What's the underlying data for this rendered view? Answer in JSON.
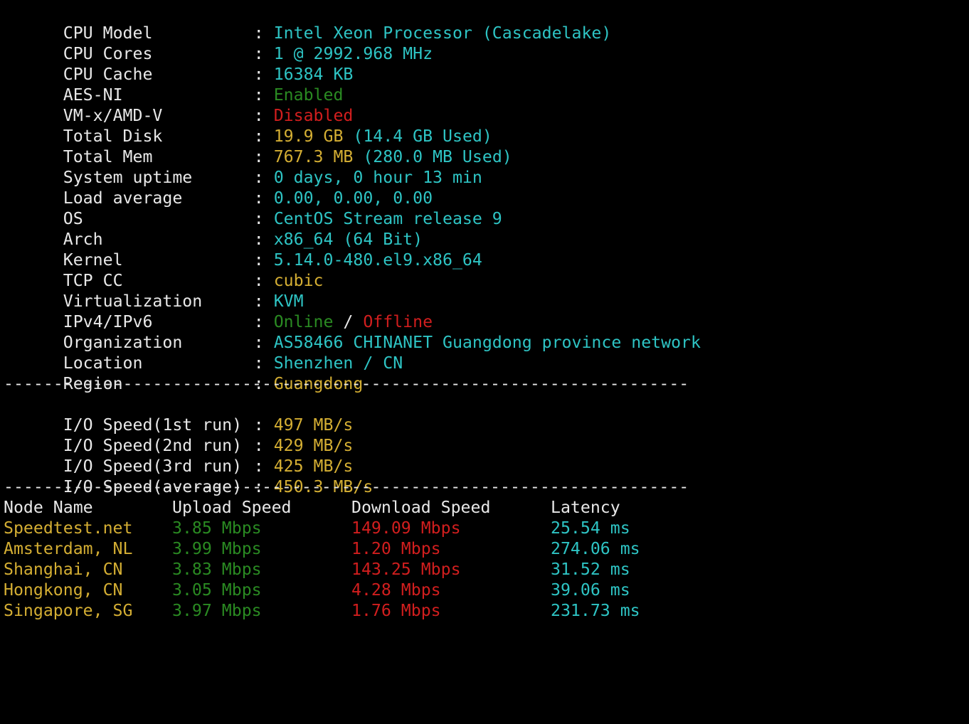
{
  "colors": {
    "background": "#000000",
    "label": "#e8e8e8",
    "cyan": "#2ec4c4",
    "green": "#2a8a22",
    "red": "#d11e1e",
    "yellow": "#d4ae33"
  },
  "sysinfo": [
    {
      "key": "CPU Model",
      "parts": [
        {
          "text": "Intel Xeon Processor (Cascadelake)",
          "color": "cyan"
        }
      ]
    },
    {
      "key": "CPU Cores",
      "parts": [
        {
          "text": "1 @ 2992.968 MHz",
          "color": "cyan"
        }
      ]
    },
    {
      "key": "CPU Cache",
      "parts": [
        {
          "text": "16384 KB",
          "color": "cyan"
        }
      ]
    },
    {
      "key": "AES-NI",
      "parts": [
        {
          "text": "Enabled",
          "color": "green"
        }
      ]
    },
    {
      "key": "VM-x/AMD-V",
      "parts": [
        {
          "text": "Disabled",
          "color": "red"
        }
      ]
    },
    {
      "key": "Total Disk",
      "parts": [
        {
          "text": "19.9 GB",
          "color": "yellow"
        },
        {
          "text": " (14.4 GB Used)",
          "color": "cyan"
        }
      ]
    },
    {
      "key": "Total Mem",
      "parts": [
        {
          "text": "767.3 MB",
          "color": "yellow"
        },
        {
          "text": " (280.0 MB Used)",
          "color": "cyan"
        }
      ]
    },
    {
      "key": "System uptime",
      "parts": [
        {
          "text": "0 days, 0 hour 13 min",
          "color": "cyan"
        }
      ]
    },
    {
      "key": "Load average",
      "parts": [
        {
          "text": "0.00, 0.00, 0.00",
          "color": "cyan"
        }
      ]
    },
    {
      "key": "OS",
      "parts": [
        {
          "text": "CentOS Stream release 9",
          "color": "cyan"
        }
      ]
    },
    {
      "key": "Arch",
      "parts": [
        {
          "text": "x86_64 (64 Bit)",
          "color": "cyan"
        }
      ]
    },
    {
      "key": "Kernel",
      "parts": [
        {
          "text": "5.14.0-480.el9.x86_64",
          "color": "cyan"
        }
      ]
    },
    {
      "key": "TCP CC",
      "parts": [
        {
          "text": "cubic",
          "color": "yellow"
        }
      ]
    },
    {
      "key": "Virtualization",
      "parts": [
        {
          "text": "KVM",
          "color": "cyan"
        }
      ]
    },
    {
      "key": "IPv4/IPv6",
      "parts": [
        {
          "text": "Online",
          "color": "green"
        },
        {
          "text": " / ",
          "color": "white"
        },
        {
          "text": "Offline",
          "color": "red"
        }
      ]
    },
    {
      "key": "Organization",
      "parts": [
        {
          "text": "AS58466 CHINANET Guangdong province network",
          "color": "cyan"
        }
      ]
    },
    {
      "key": "Location",
      "parts": [
        {
          "text": "Shenzhen / CN",
          "color": "cyan"
        }
      ]
    },
    {
      "key": "Region",
      "parts": [
        {
          "text": "Guangdong",
          "color": "yellow"
        }
      ]
    }
  ],
  "separator": "---------------------------------------------------------------------",
  "colon": ": ",
  "io": [
    {
      "key": "I/O Speed(1st run)",
      "value": "497 MB/s"
    },
    {
      "key": "I/O Speed(2nd run)",
      "value": "429 MB/s"
    },
    {
      "key": "I/O Speed(3rd run)",
      "value": "425 MB/s"
    },
    {
      "key": "I/O Speed(average)",
      "value": "450.3 MB/s"
    }
  ],
  "speedtest": {
    "headers": [
      "Node Name",
      "Upload Speed",
      "Download Speed",
      "Latency"
    ],
    "rows": [
      {
        "node": "Speedtest.net",
        "upload": "3.85 Mbps",
        "download": "149.09 Mbps",
        "latency": "25.54 ms"
      },
      {
        "node": "Amsterdam, NL",
        "upload": "3.99 Mbps",
        "download": "1.20 Mbps",
        "latency": "274.06 ms"
      },
      {
        "node": "Shanghai, CN",
        "upload": "3.83 Mbps",
        "download": "143.25 Mbps",
        "latency": "31.52 ms"
      },
      {
        "node": "Hongkong, CN",
        "upload": "3.05 Mbps",
        "download": "4.28 Mbps",
        "latency": "39.06 ms"
      },
      {
        "node": "Singapore, SG",
        "upload": "3.97 Mbps",
        "download": "1.76 Mbps",
        "latency": "231.73 ms"
      }
    ]
  }
}
